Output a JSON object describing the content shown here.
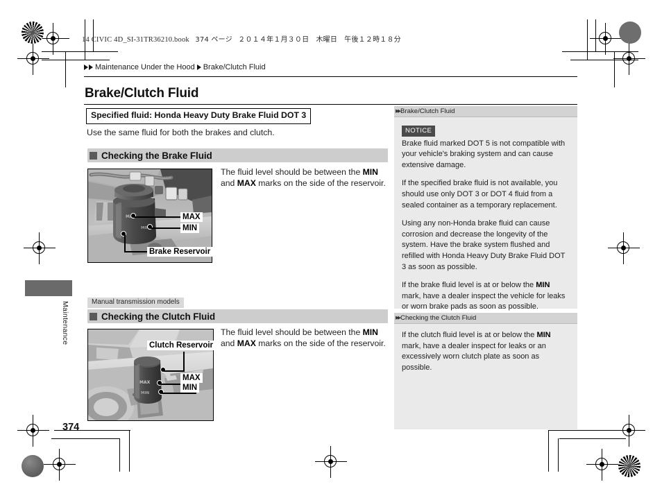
{
  "print": {
    "file_stamp_en": "14 CIVIC 4D_SI-31TR36210.book",
    "file_stamp_page": "374 ページ",
    "file_stamp_date": "２０１４年１月３０日　木曜日　午後１２時１８分"
  },
  "breadcrumb": {
    "section": "Maintenance Under the Hood",
    "topic": "Brake/Clutch Fluid"
  },
  "page": {
    "title": "Brake/Clutch Fluid",
    "number": "374",
    "edge_tab_label": "Maintenance"
  },
  "spec": {
    "fluid_box": "Specified fluid: Honda Heavy Duty Brake Fluid DOT 3",
    "lead": "Use the same fluid for both the brakes and clutch."
  },
  "sections": [
    {
      "heading": "Checking the Brake Fluid",
      "tag": null,
      "body_line1_pre": "The fluid level should be between the ",
      "body_line1_bold": "MIN",
      "body_line2_pre": "and ",
      "body_line2_bold": "MAX",
      "body_line2_post": " marks on the side of the reservoir."
    },
    {
      "heading": "Checking the Clutch Fluid",
      "tag": "Manual transmission models",
      "body_line1_pre": "The fluid level should be between the ",
      "body_line1_bold": "MIN",
      "body_line2_pre": "and ",
      "body_line2_bold": "MAX",
      "body_line2_post": " marks on the side of the reservoir."
    }
  ],
  "figures": {
    "brake": {
      "alt": "brake-fluid-reservoir-photo",
      "callouts": {
        "max": "MAX",
        "min": "MIN",
        "reservoir": "Brake Reservoir",
        "cap_max": "MAX",
        "cap_min": "MIN"
      }
    },
    "clutch": {
      "alt": "clutch-fluid-reservoir-photo",
      "callouts": {
        "reservoir": "Clutch Reservoir",
        "max": "MAX",
        "min": "MIN",
        "cap_max": "MAX",
        "cap_min": "MIN"
      }
    }
  },
  "sidebar": {
    "panels": [
      {
        "header": "Brake/Clutch Fluid",
        "notice_badge": "NOTICE",
        "paragraphs": [
          "Brake fluid marked DOT 5 is not compatible with your vehicle's braking system and can cause extensive damage.",
          "If the specified brake fluid is not available, you should use only DOT 3 or DOT 4 fluid from a sealed container as a temporary replacement.",
          "Using any non-Honda brake fluid can cause corrosion and decrease the longevity of the system. Have the brake system flushed and refilled with Honda Heavy Duty Brake Fluid DOT 3 as soon as possible."
        ],
        "min_paragraph": {
          "pre": "If the brake fluid level is at or below the ",
          "bold": "MIN",
          "post": " mark, have a dealer inspect the vehicle for leaks or worn brake pads as soon as possible."
        }
      },
      {
        "header": "Checking the Clutch Fluid",
        "min_paragraph": {
          "pre": "If the clutch fluid level is at or below the ",
          "bold": "MIN",
          "post": " mark, have a dealer inspect for leaks or an excessively worn clutch plate as soon as possible."
        }
      }
    ]
  },
  "colors": {
    "section_bar": "#cdcdcd",
    "sidebar_bg": "#eaeaea",
    "sidebar_head": "#d3d3d3",
    "notice_badge": "#4a4a4a",
    "edge_tab": "#6a6a6a"
  }
}
